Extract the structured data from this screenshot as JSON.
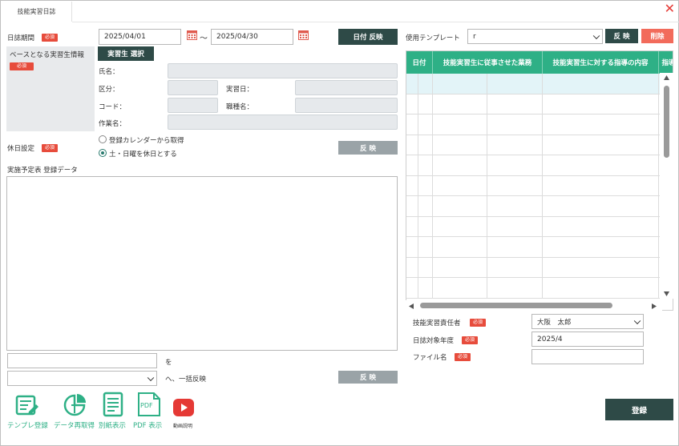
{
  "window": {
    "tab_label": "技能実習日誌",
    "close_glyph": "✕"
  },
  "period": {
    "label": "日誌期間",
    "required": "必須",
    "from": "2025/04/01",
    "separator": "〜",
    "to": "2025/04/30",
    "apply_button": "日付 反映"
  },
  "trainee": {
    "section_label": "ベースとなる実習生情報",
    "required": "必須",
    "select_button": "実習生 選択",
    "name_label": "氏名：",
    "category_label": "区分：",
    "practice_date_label": "実習日：",
    "code_label": "コード：",
    "job_label": "職種名：",
    "work_label": "作業名："
  },
  "holiday": {
    "label": "休日設定",
    "required": "必須",
    "option1": "登録カレンダーから取得",
    "option2": "土・日曜を休日とする",
    "selected": "option2",
    "apply_button": "反 映"
  },
  "schedule": {
    "label": "実施予定表 登録データ"
  },
  "bulk": {
    "wo_label": "を",
    "apply_suffix": "へ、一括反映",
    "apply_button": "反 映"
  },
  "template": {
    "label": "使用テンプレート",
    "value": "r",
    "apply_button": "反 映",
    "delete_button": "削除"
  },
  "grid": {
    "columns": [
      "日付",
      "技能実習生に従事させた業務",
      "技能実習生に対する指導の内容",
      "指導"
    ],
    "row_count": 11
  },
  "form": {
    "responsible_label": "技能実習責任者",
    "responsible_required": "必須",
    "responsible_value": "大阪　太郎",
    "year_label": "日誌対象年度",
    "year_required": "必須",
    "year_value": "2025/4",
    "filename_label": "ファイル名",
    "filename_required": "必須",
    "filename_value": ""
  },
  "toolbar": {
    "template_register": "テンプレ登録",
    "data_reload": "データ再取得",
    "separate_sheet": "別紙表示",
    "pdf_view": "PDF 表示",
    "video_help": "動画説明",
    "pdf_icon_text": "PDF"
  },
  "register_button": "登録",
  "colors": {
    "accent_green": "#2eb086",
    "dark_button": "#2e4a47",
    "gray_button": "#9aa3a7",
    "required_red": "#e74c3c",
    "delete_red": "#f26b5b",
    "youtube_red": "#e53935"
  }
}
